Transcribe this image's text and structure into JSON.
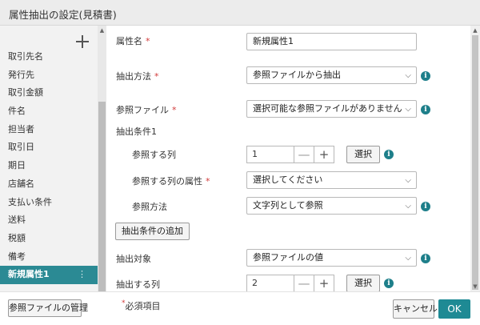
{
  "dialog": {
    "title": "属性抽出の設定(見積書)"
  },
  "sidebar": {
    "items": [
      {
        "label": "取引先名"
      },
      {
        "label": "発行先"
      },
      {
        "label": "取引金額"
      },
      {
        "label": "件名"
      },
      {
        "label": "担当者"
      },
      {
        "label": "取引日"
      },
      {
        "label": "期日"
      },
      {
        "label": "店舗名"
      },
      {
        "label": "支払い条件"
      },
      {
        "label": "送料"
      },
      {
        "label": "税額"
      },
      {
        "label": "備考"
      },
      {
        "label": "新規属性1",
        "active": true,
        "menu_glyph": "⋮"
      }
    ]
  },
  "form": {
    "required_mark": "*",
    "attr_name": {
      "label": "属性名",
      "value": "新規属性1"
    },
    "extract_method": {
      "label": "抽出方法",
      "value": "参照ファイルから抽出"
    },
    "ref_file": {
      "label": "参照ファイル",
      "value": "選択可能な参照ファイルがありません"
    },
    "condition1": {
      "heading": "抽出条件1",
      "ref_column": {
        "label": "参照する列",
        "value": "1",
        "select_label": "選択"
      },
      "ref_column_attr": {
        "label": "参照する列の属性",
        "value": "選択してください"
      },
      "ref_method": {
        "label": "参照方法",
        "value": "文字列として参照"
      }
    },
    "add_condition_label": "抽出条件の追加",
    "extract_target": {
      "label": "抽出対象",
      "value": "参照ファイルの値"
    },
    "extract_column": {
      "label": "抽出する列",
      "value": "2",
      "select_label": "選択"
    }
  },
  "footer": {
    "manage_ref_label": "参照ファイルの管理",
    "required_note": "必須項目",
    "cancel_label": "キャンセル",
    "ok_label": "OK"
  },
  "glyphs": {
    "chevron": "⌵",
    "minus": "—",
    "plus": "+",
    "info": "i",
    "up": "▲",
    "down": "▼"
  },
  "colors": {
    "accent": "#1e8a94",
    "active_item": "#2b8a94",
    "required": "#d23a3a"
  }
}
